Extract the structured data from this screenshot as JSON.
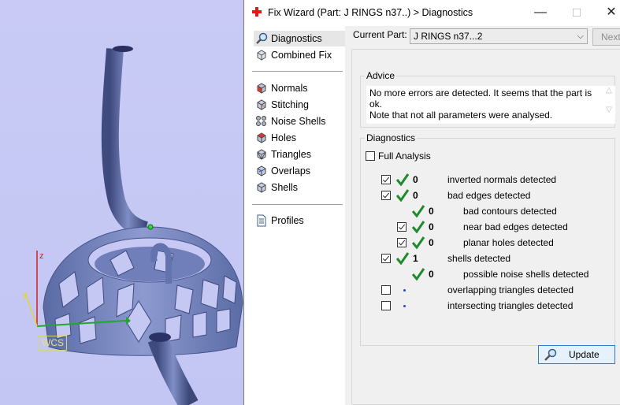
{
  "window": {
    "title": "Fix Wizard (Part: J RINGS n37..) > Diagnostics",
    "minimize": "—",
    "maximize": "☐",
    "close": "✕"
  },
  "viewport": {
    "axis_z": "z",
    "axis_y": "y",
    "wcs_label": "WCS",
    "colors": {
      "part": "#6b7cb4",
      "x_axis": "#1fa82a",
      "y_axis": "#e2d240",
      "z_axis": "#d42020"
    }
  },
  "nav": {
    "items": [
      {
        "label": "Diagnostics",
        "icon": "magnifier-icon",
        "selected": true
      },
      {
        "label": "Combined Fix",
        "icon": "combined-fix-icon"
      },
      {
        "label": "Normals",
        "icon": "normals-cube-icon"
      },
      {
        "label": "Stitching",
        "icon": "stitching-cube-icon"
      },
      {
        "label": "Noise Shells",
        "icon": "noise-shells-icon"
      },
      {
        "label": "Holes",
        "icon": "holes-cube-icon"
      },
      {
        "label": "Triangles",
        "icon": "triangles-cube-icon"
      },
      {
        "label": "Overlaps",
        "icon": "overlaps-cube-icon"
      },
      {
        "label": "Shells",
        "icon": "shells-cube-icon"
      },
      {
        "label": "Profiles",
        "icon": "profiles-document-icon"
      }
    ]
  },
  "current_part": {
    "label": "Current Part:",
    "value": "J RINGS n37...2",
    "next_label": "Next"
  },
  "advice": {
    "title": "Advice",
    "text": "No more errors are detected. It seems that the part is ok.\nNote that not all parameters were analysed."
  },
  "diagnostics": {
    "title": "Diagnostics",
    "full_analysis_label": "Full Analysis",
    "rows": [
      {
        "count": "0",
        "label": "inverted normals detected",
        "checked": true,
        "status": "ok"
      },
      {
        "count": "0",
        "label": "bad edges detected",
        "checked": true,
        "status": "ok"
      },
      {
        "count": "0",
        "label": "bad contours detected",
        "checked": null,
        "status": "ok"
      },
      {
        "count": "0",
        "label": "near bad edges detected",
        "checked": true,
        "status": "ok"
      },
      {
        "count": "0",
        "label": "planar holes detected",
        "checked": true,
        "status": "ok"
      },
      {
        "count": "1",
        "label": "shells detected",
        "checked": true,
        "status": "ok"
      },
      {
        "count": "0",
        "label": "possible noise shells detected",
        "checked": null,
        "status": "ok"
      },
      {
        "count": "",
        "label": "overlapping triangles detected",
        "checked": false,
        "status": "pending"
      },
      {
        "count": "",
        "label": "intersecting triangles detected",
        "checked": false,
        "status": "pending"
      }
    ],
    "update_label": "Update"
  }
}
